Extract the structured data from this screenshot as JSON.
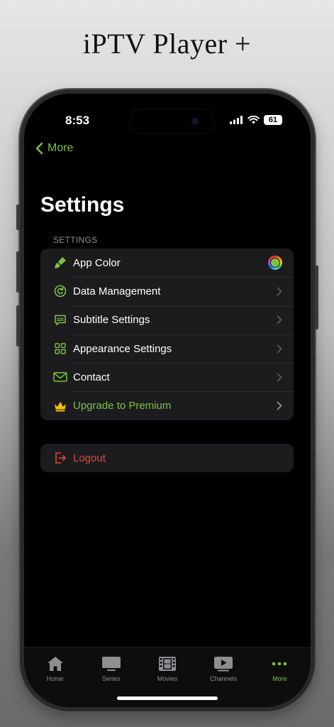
{
  "promo": {
    "title": "iPTV Player +"
  },
  "status_bar": {
    "time": "8:53",
    "battery": "61"
  },
  "nav": {
    "back_label": "More"
  },
  "page": {
    "title": "Settings",
    "section_header": "SETTINGS"
  },
  "settings_items": [
    {
      "label": "App Color",
      "icon": "paintbrush-icon",
      "accessory": "color-swatch"
    },
    {
      "label": "Data Management",
      "icon": "refresh-circle-icon",
      "accessory": "chevron"
    },
    {
      "label": "Subtitle Settings",
      "icon": "subtitle-icon",
      "accessory": "chevron"
    },
    {
      "label": "Appearance Settings",
      "icon": "grid-icon",
      "accessory": "chevron"
    },
    {
      "label": "Contact",
      "icon": "envelope-icon",
      "accessory": "chevron"
    },
    {
      "label": "Upgrade to Premium",
      "icon": "crown-icon",
      "accessory": "chevron"
    }
  ],
  "logout": {
    "label": "Logout",
    "icon": "logout-icon"
  },
  "tabs": [
    {
      "label": "Home",
      "icon": "house-icon",
      "active": false
    },
    {
      "label": "Series",
      "icon": "tv-icon",
      "active": false
    },
    {
      "label": "Movies",
      "icon": "film-icon",
      "active": false
    },
    {
      "label": "Channels",
      "icon": "play-rectangle-icon",
      "active": false
    },
    {
      "label": "More",
      "icon": "ellipsis-icon",
      "active": true
    }
  ],
  "colors": {
    "accent": "#7cc242",
    "destructive": "#e0443b",
    "premium": "#f5c400",
    "background": "#000000",
    "cell": "#1c1c1e"
  }
}
